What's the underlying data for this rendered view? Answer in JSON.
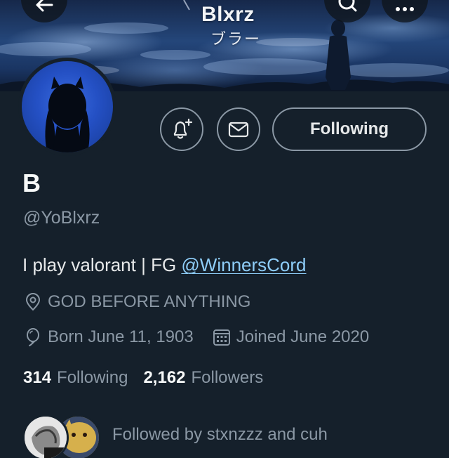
{
  "banner": {
    "title": "Blxrz",
    "subtitle": "ブラー"
  },
  "header_buttons": {
    "back_icon": "arrow-left-icon",
    "search_icon": "search-icon",
    "more_icon": "more-dots-icon"
  },
  "actions": {
    "notify_icon": "bell-plus-icon",
    "message_icon": "mail-icon",
    "following_label": "Following"
  },
  "profile": {
    "display_name": "B",
    "handle": "@YoBlxrz",
    "bio_text": "I play valorant | FG ",
    "bio_link": "@WinnersCord",
    "location": "GOD BEFORE ANYTHING",
    "birth": "Born June 11, 1903",
    "joined": "Joined June 2020"
  },
  "stats": {
    "following_count": "314",
    "following_label": "Following",
    "followers_count": "2,162",
    "followers_label": "Followers"
  },
  "followed_by": {
    "text": "Followed by stxnzzz and cuh"
  },
  "colors": {
    "background": "#15202b",
    "muted_text": "#8b98a5",
    "link": "#8ecdf8",
    "avatar_blue": "#2450c4"
  }
}
